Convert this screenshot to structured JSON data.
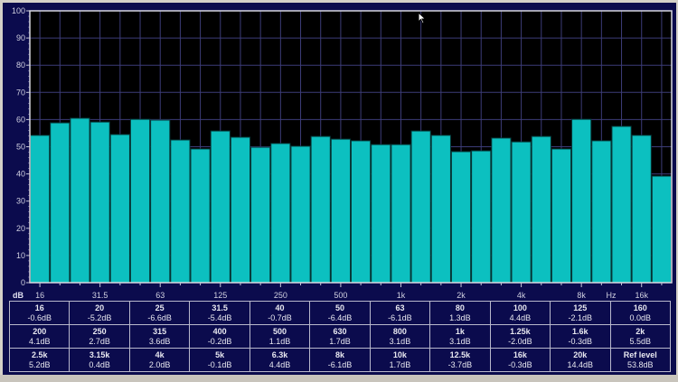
{
  "chart_data": {
    "type": "bar",
    "title": "",
    "ylabel": "dB",
    "xlabel": "Hz",
    "ylim": [
      0,
      100
    ],
    "yticks": [
      "0",
      "10",
      "20",
      "30",
      "40",
      "50",
      "60",
      "70",
      "80",
      "90",
      "100"
    ],
    "grid": true,
    "xtick_labels": [
      "16",
      "31.5",
      "63",
      "125",
      "250",
      "500",
      "1k",
      "2k",
      "4k",
      "8k",
      "16k"
    ],
    "categories": [
      "16",
      "20",
      "25",
      "31.5",
      "40",
      "50",
      "63",
      "80",
      "100",
      "125",
      "160",
      "200",
      "250",
      "315",
      "400",
      "500",
      "630",
      "800",
      "1k",
      "1.25k",
      "1.6k",
      "2k",
      "2.5k",
      "3.15k",
      "4k",
      "5k",
      "6.3k",
      "8k",
      "10k",
      "12.5k",
      "16k",
      "20k"
    ],
    "values": [
      54.2,
      58.8,
      60.5,
      59.1,
      54.5,
      60.1,
      59.8,
      52.5,
      49.2,
      55.8,
      53.5,
      49.8,
      51.2,
      50.2,
      53.8,
      52.8,
      52.2,
      50.8,
      50.8,
      55.8,
      54.2,
      48.2,
      48.5,
      53.2,
      51.8,
      53.8,
      49.2,
      60.1,
      52.2,
      57.5,
      54.2,
      39.2
    ],
    "bar_color": "#0cc0c0"
  },
  "table": [
    [
      [
        "16",
        "-0.6dB"
      ],
      [
        "20",
        "-5.2dB"
      ],
      [
        "25",
        "-6.6dB"
      ],
      [
        "31.5",
        "-5.4dB"
      ],
      [
        "40",
        "-0.7dB"
      ],
      [
        "50",
        "-6.4dB"
      ],
      [
        "63",
        "-6.1dB"
      ],
      [
        "80",
        "1.3dB"
      ],
      [
        "100",
        "4.4dB"
      ],
      [
        "125",
        "-2.1dB"
      ],
      [
        "160",
        "0.0dB"
      ]
    ],
    [
      [
        "200",
        "4.1dB"
      ],
      [
        "250",
        "2.7dB"
      ],
      [
        "315",
        "3.6dB"
      ],
      [
        "400",
        "-0.2dB"
      ],
      [
        "500",
        "1.1dB"
      ],
      [
        "630",
        "1.7dB"
      ],
      [
        "800",
        "3.1dB"
      ],
      [
        "1k",
        "3.1dB"
      ],
      [
        "1.25k",
        "-2.0dB"
      ],
      [
        "1.6k",
        "-0.3dB"
      ],
      [
        "2k",
        "5.5dB"
      ]
    ],
    [
      [
        "2.5k",
        "5.2dB"
      ],
      [
        "3.15k",
        "0.4dB"
      ],
      [
        "4k",
        "2.0dB"
      ],
      [
        "5k",
        "-0.1dB"
      ],
      [
        "6.3k",
        "4.4dB"
      ],
      [
        "8k",
        "-6.1dB"
      ],
      [
        "10k",
        "1.7dB"
      ],
      [
        "12.5k",
        "-3.7dB"
      ],
      [
        "16k",
        "-0.3dB"
      ],
      [
        "20k",
        "14.4dB"
      ],
      [
        "Ref level",
        "53.8dB"
      ]
    ]
  ]
}
